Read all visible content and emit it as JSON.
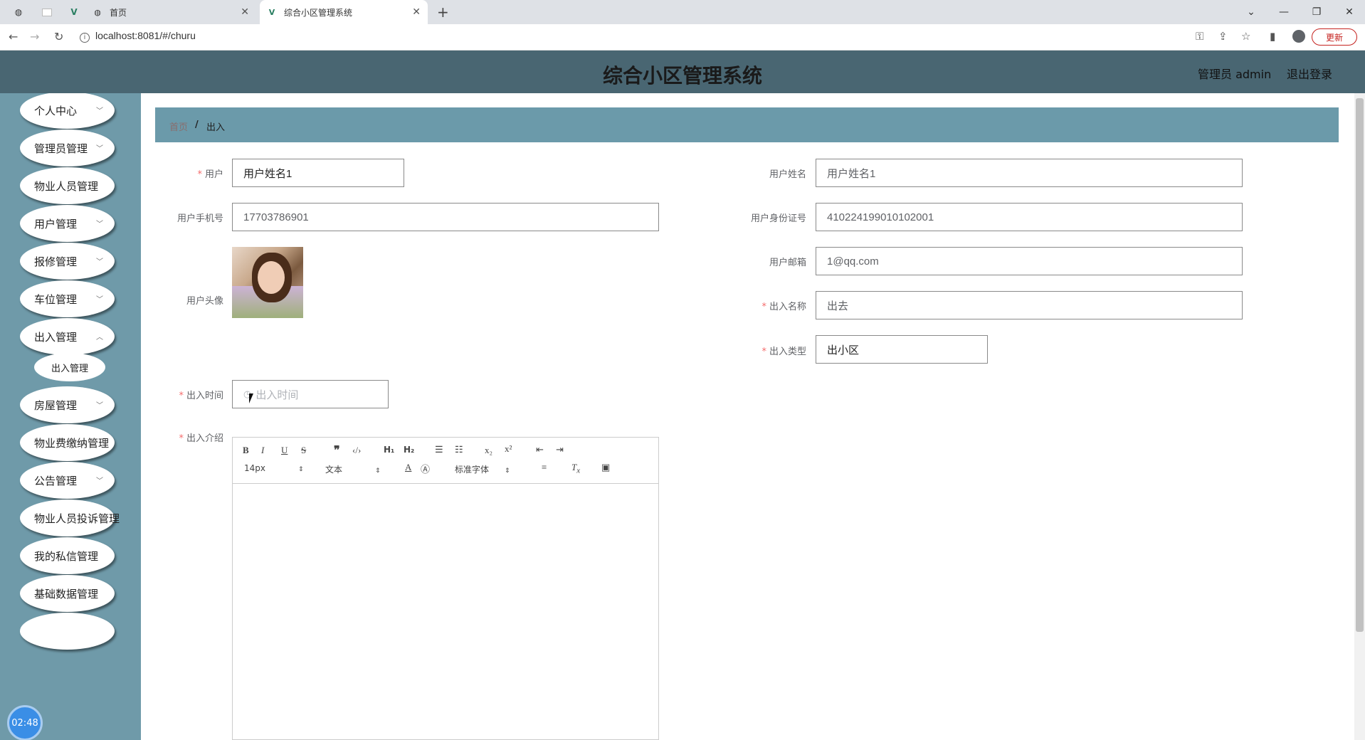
{
  "browser": {
    "tabs": [
      {
        "label": "首页"
      },
      {
        "label": "综合小区管理系统"
      }
    ],
    "url": "localhost:8081/#/churu",
    "update_label": "更新"
  },
  "header": {
    "title": "综合小区管理系统",
    "user_label": "管理员 admin",
    "logout_label": "退出登录"
  },
  "sidebar": {
    "items": [
      {
        "label": "个人中心",
        "has_children": true
      },
      {
        "label": "管理员管理",
        "has_children": true
      },
      {
        "label": "物业人员管理",
        "has_children": false
      },
      {
        "label": "用户管理",
        "has_children": true
      },
      {
        "label": "报修管理",
        "has_children": true
      },
      {
        "label": "车位管理",
        "has_children": true
      },
      {
        "label": "出入管理",
        "has_children": true
      },
      {
        "label": "房屋管理",
        "has_children": true
      },
      {
        "label": "物业费缴纳管理",
        "has_children": false
      },
      {
        "label": "公告管理",
        "has_children": true
      },
      {
        "label": "物业人员投诉管理",
        "has_children": false
      },
      {
        "label": "我的私信管理",
        "has_children": false
      },
      {
        "label": "基础数据管理",
        "has_children": false
      }
    ],
    "submenu": {
      "label": "出入管理"
    },
    "clock": "02:48"
  },
  "breadcrumb": {
    "home": "首页",
    "separator": "/",
    "current": "出入"
  },
  "form": {
    "user": {
      "label": "用户",
      "value": "用户姓名1"
    },
    "user_name": {
      "label": "用户姓名",
      "value": "用户姓名1"
    },
    "user_phone": {
      "label": "用户手机号",
      "value": "17703786901"
    },
    "user_id_card": {
      "label": "用户身份证号",
      "value": "410224199010102001"
    },
    "user_avatar": {
      "label": "用户头像"
    },
    "user_email": {
      "label": "用户邮箱",
      "value": "1@qq.com"
    },
    "churu_name": {
      "label": "出入名称",
      "value": "出去"
    },
    "churu_type": {
      "label": "出入类型",
      "value": "出小区"
    },
    "churu_time": {
      "label": "出入时间",
      "placeholder": "出入时间"
    },
    "churu_content": {
      "label": "出入介绍"
    }
  },
  "editor": {
    "font_size": "14px",
    "header_select": "文本",
    "font_family": "标准字体"
  }
}
